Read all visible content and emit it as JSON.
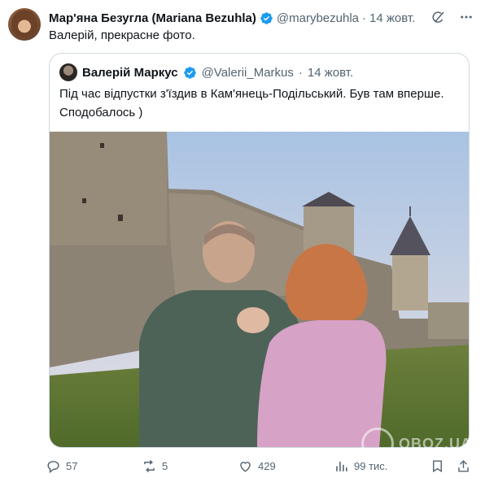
{
  "tweet": {
    "author_name": "Мар'яна Безугла (Mariana Bezuhla)",
    "handle": "@marybezuhla",
    "dot": "·",
    "time": "14 жовт.",
    "text": "Валерій, прекрасне фото."
  },
  "quote": {
    "author_name": "Валерій Маркус",
    "handle": "@Valerii_Markus",
    "dot": "·",
    "time": "14 жовт.",
    "text": "Під час відпустки з'їздив в Кам'янець-Подільський. Був там вперше. Сподобалось )"
  },
  "actions": {
    "replies": "57",
    "retweets": "5",
    "likes": "429",
    "views": "99 тис."
  },
  "watermark": "OBOZ.UA",
  "colors": {
    "verified": "#1d9bf0",
    "muted": "#536471",
    "border": "#cfd9de"
  }
}
